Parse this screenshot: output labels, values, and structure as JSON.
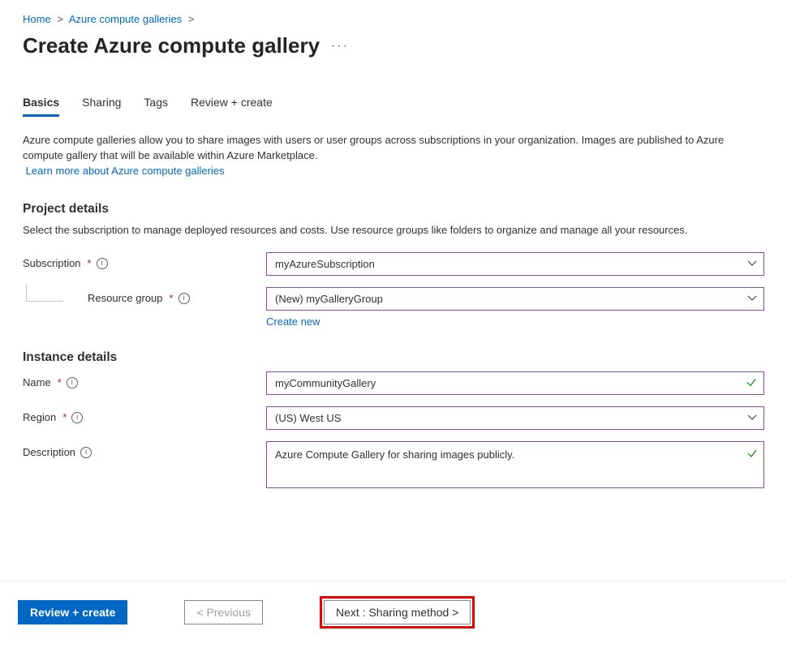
{
  "breadcrumb": {
    "home": "Home",
    "galleries": "Azure compute galleries"
  },
  "title": "Create Azure compute gallery",
  "title_menu": "···",
  "tabs": {
    "basics": "Basics",
    "sharing": "Sharing",
    "tags": "Tags",
    "review": "Review + create"
  },
  "intro": {
    "line": "Azure compute galleries allow you to share images with users or user groups across subscriptions in your organization. Images are published to Azure compute gallery that will be available within Azure Marketplace.",
    "learn_more": "Learn more about Azure compute galleries"
  },
  "sections": {
    "project": {
      "heading": "Project details",
      "desc": "Select the subscription to manage deployed resources and costs. Use resource groups like folders to organize and manage all your resources."
    },
    "instance": {
      "heading": "Instance details"
    }
  },
  "fields": {
    "subscription": {
      "label": "Subscription",
      "value": "myAzureSubscription"
    },
    "resource_group": {
      "label": "Resource group",
      "value": "(New) myGalleryGroup",
      "create_new": "Create new"
    },
    "name": {
      "label": "Name",
      "value": "myCommunityGallery"
    },
    "region": {
      "label": "Region",
      "value": "(US) West US"
    },
    "description": {
      "label": "Description",
      "value": "Azure Compute Gallery for sharing images publicly."
    }
  },
  "footer": {
    "review": "Review + create",
    "previous": "< Previous",
    "next": "Next : Sharing method >"
  }
}
